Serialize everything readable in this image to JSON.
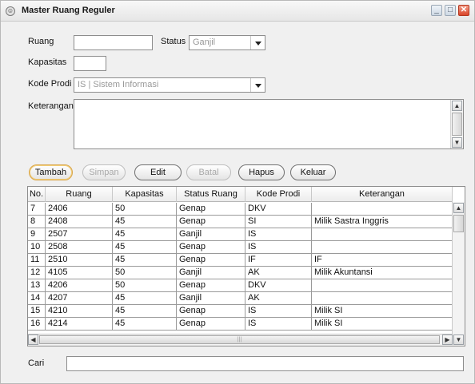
{
  "window": {
    "title": "Master Ruang Reguler"
  },
  "form": {
    "ruang_label": "Ruang",
    "ruang_value": "",
    "status_label": "Status",
    "status_value": "Ganjil",
    "kapasitas_label": "Kapasitas",
    "kapasitas_value": "",
    "kode_prodi_label": "Kode Prodi",
    "kode_prodi_value": "IS | Sistem Informasi",
    "keterangan_label": "Keterangan",
    "keterangan_value": ""
  },
  "buttons": {
    "tambah": "Tambah",
    "simpan": "Simpan",
    "edit": "Edit",
    "batal": "Batal",
    "hapus": "Hapus",
    "keluar": "Keluar"
  },
  "table": {
    "columns": [
      "No.",
      "Ruang",
      "Kapasitas",
      "Status Ruang",
      "Kode Prodi",
      "Keterangan"
    ],
    "rows": [
      [
        "7",
        "2406",
        "50",
        "Genap",
        "DKV",
        ""
      ],
      [
        "8",
        "2408",
        "45",
        "Genap",
        "SI",
        "Milik Sastra Inggris"
      ],
      [
        "9",
        "2507",
        "45",
        "Ganjil",
        "IS",
        ""
      ],
      [
        "10",
        "2508",
        "45",
        "Genap",
        "IS",
        ""
      ],
      [
        "11",
        "2510",
        "45",
        "Genap",
        "IF",
        "IF"
      ],
      [
        "12",
        "4105",
        "50",
        "Ganjil",
        "AK",
        "Milik Akuntansi"
      ],
      [
        "13",
        "4206",
        "50",
        "Genap",
        "DKV",
        ""
      ],
      [
        "14",
        "4207",
        "45",
        "Ganjil",
        "AK",
        ""
      ],
      [
        "15",
        "4210",
        "45",
        "Genap",
        "IS",
        "Milik SI"
      ],
      [
        "16",
        "4214",
        "45",
        "Genap",
        "IS",
        "Milik SI"
      ]
    ]
  },
  "search": {
    "label": "Cari",
    "value": ""
  },
  "icons": {
    "window": "app-icon",
    "minimize": "minimize-icon",
    "maximize": "maximize-icon",
    "close": "close-icon"
  }
}
